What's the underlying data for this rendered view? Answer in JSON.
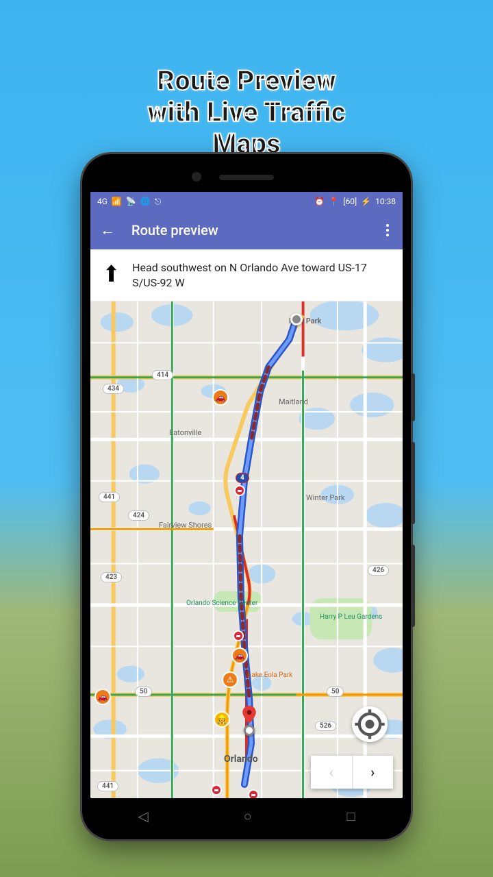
{
  "promo": {
    "line1": "Route Preview",
    "line2": "with Live Traffic Maps"
  },
  "statusbar": {
    "network": "4G",
    "time": "10:38",
    "battery": "60"
  },
  "appbar": {
    "title": "Route preview"
  },
  "instruction": {
    "text": "Head southwest on N Orlando Ave toward US-17 S/US-92 W"
  },
  "map": {
    "places": {
      "fern_park": "Fern Park",
      "maitland": "Maitland",
      "eatonville": "Eatonville",
      "fairview": "Fairview Shores",
      "winter_park": "Winter Park",
      "orlando": "Orlando"
    },
    "pois": {
      "science_center": "Orlando Science Center",
      "leu_gardens": "Harry P Leu Gardens",
      "eola": "Lake Eola Park"
    },
    "shields": {
      "i4": "4",
      "r414": "414",
      "r434": "434",
      "r441a": "441",
      "r441b": "441",
      "r424": "424",
      "r423": "423",
      "r426": "426",
      "r50a": "50",
      "r50b": "50",
      "r526": "526"
    }
  },
  "colors": {
    "appbar": "#5c6bc0",
    "route": "#6e9bff",
    "traffic_red": "#d93025",
    "traffic_orange": "#f29900",
    "traffic_green": "#34a853"
  }
}
